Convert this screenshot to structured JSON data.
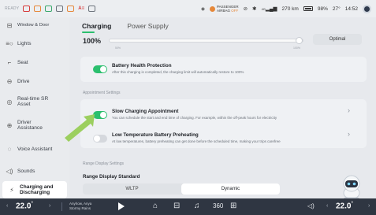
{
  "status": {
    "ready": "READY",
    "abs": "A≡",
    "passenger_line1": "PASSENGER",
    "passenger_line2": "AIRBAG",
    "passenger_off": "OFF",
    "range": "270 km",
    "battery": "98%",
    "outside_temp": "27°",
    "time": "14:52",
    "signal": "4G"
  },
  "sidebar": {
    "items": [
      {
        "label": "Window & Door",
        "icon": "door-icon"
      },
      {
        "label": "Lights",
        "icon": "lights-icon"
      },
      {
        "label": "Seat",
        "icon": "seat-icon"
      },
      {
        "label": "Drive",
        "icon": "drive-icon"
      },
      {
        "label": "Real-time SR Asset",
        "icon": "sr-icon"
      },
      {
        "label": "Driver Assistance",
        "icon": "steering-icon"
      },
      {
        "label": "Voice Assistant",
        "icon": "voice-icon"
      },
      {
        "label": "Sounds",
        "icon": "speaker-icon"
      },
      {
        "label": "Charging and Discharging",
        "icon": "charging-icon"
      }
    ]
  },
  "tabs": [
    {
      "label": "Charging"
    },
    {
      "label": "Power Supply"
    }
  ],
  "charge_limit": {
    "value_label": "100%",
    "level_percent": 100,
    "tick_min": "50%",
    "tick_max": "100%",
    "optimal_label": "Optimal"
  },
  "battery_health": {
    "title": "Battery Health Protection",
    "desc": "After this charging is completed, the charging limit will automatically restore to 100%",
    "enabled": true
  },
  "appointment": {
    "section_label": "Appointment Settings",
    "slow_title": "Slow Charging Appointment",
    "slow_desc": "You can schedule the start and end time of charging. For example, within the off-peak hours for electricity",
    "slow_enabled": true,
    "lowtemp_title": "Low Temperature Battery Preheating",
    "lowtemp_desc": "At low temperatures, battery preheating can get done before the scheduled time, making your trips carefree",
    "lowtemp_enabled": false
  },
  "range_display": {
    "section_label": "Range Display Settings",
    "title": "Range Display Standard",
    "options": [
      "WLTP",
      "Dynamic"
    ],
    "selected": "Dynamic"
  },
  "bottom": {
    "temp_left": "22.0",
    "temp_right": "22.0",
    "temp_unit": "°",
    "music_line1": "Anyhow, Anya",
    "music_line2": "Stormy Rains"
  },
  "colors": {
    "accent": "#2bbf6e",
    "arrow": "#9ccf5f"
  }
}
